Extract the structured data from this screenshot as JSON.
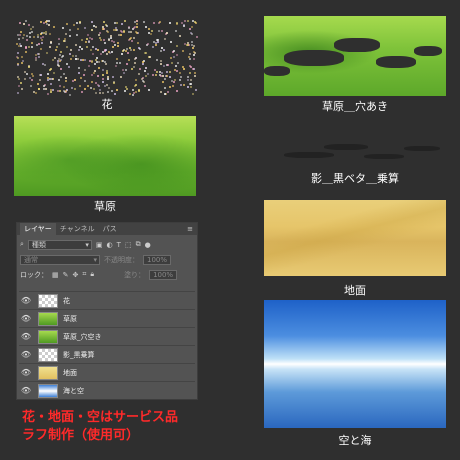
{
  "captions": {
    "flowers": "花",
    "grass": "草原",
    "grass_hole": "草原＿穴あき",
    "shadow": "影＿黒ベタ＿乗算",
    "ground": "地面",
    "sky": "空と海"
  },
  "panel": {
    "tabs": [
      "レイヤー",
      "チャンネル",
      "パス"
    ],
    "filter_select": "種類",
    "blend_mode": "通常",
    "opacity_label": "不透明度：",
    "opacity_value": "100%",
    "lock_label": "ロック：",
    "fill_label": "塗り：",
    "fill_value": "100%",
    "layers": [
      {
        "name": "花",
        "thumb": "checker"
      },
      {
        "name": "草原",
        "thumb": "grass"
      },
      {
        "name": "草原_穴空き",
        "thumb": "grass"
      },
      {
        "name": "影_黒乗算",
        "thumb": "checker"
      },
      {
        "name": "地面",
        "thumb": "ground"
      },
      {
        "name": "海と空",
        "thumb": "sky"
      }
    ]
  },
  "notes": {
    "line1": "花・地面・空はサービス品",
    "line2": "ラフ制作（使用可）"
  },
  "colors": {
    "background": "#2f2f2f",
    "note_red": "#ff2a2a",
    "panel_bg": "#535353"
  }
}
